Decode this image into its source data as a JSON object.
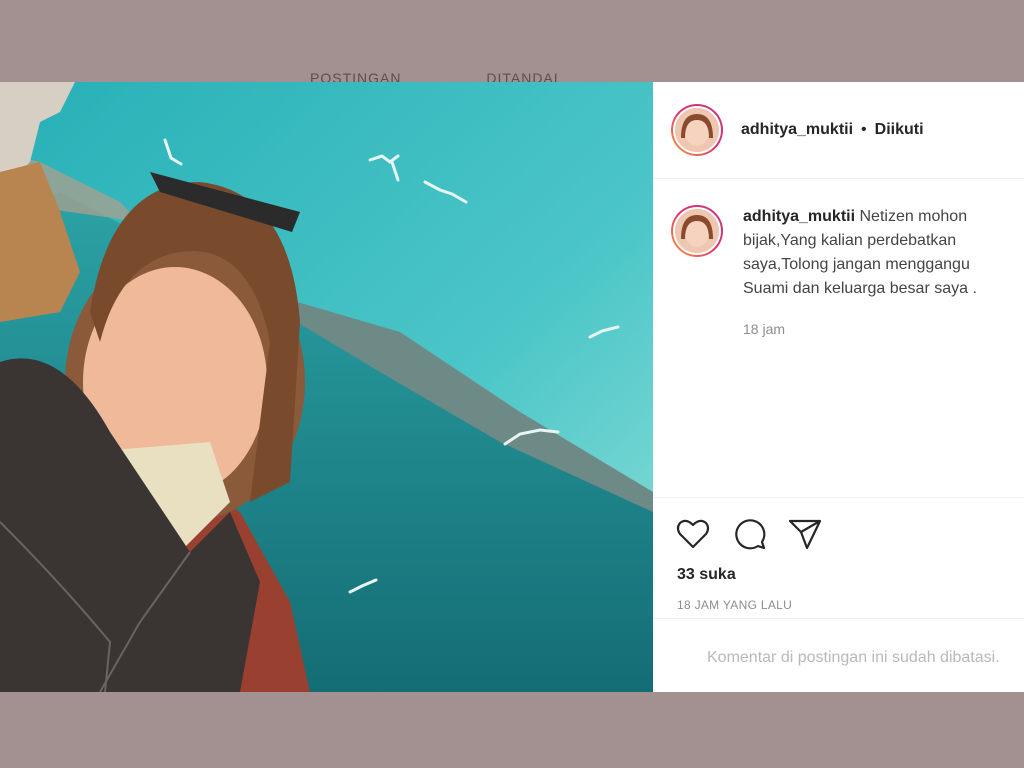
{
  "background_tabs": {
    "posts_label": "POSTINGAN",
    "tagged_label": "DITANDAI"
  },
  "post": {
    "username": "adhitya_muktii",
    "separator": "•",
    "follow_status": "Diikuti",
    "caption_username": "adhitya_muktii",
    "caption_text": "Netizen mohon bijak,Yang kalian perdebatkan saya,Tolong jangan menggangu Suami dan keluarga besar saya .",
    "caption_time": "18 jam",
    "likes": "33 suka",
    "posted_ago": "18 JAM YANG LALU",
    "comments_disabled": "Komentar di postingan ini sudah dibatasi."
  },
  "icons": [
    "heart-icon",
    "comment-icon",
    "share-icon"
  ],
  "colors": {
    "backdrop": "#a39090",
    "sky": "#2fb3b8",
    "sea": "#1d8a8f",
    "text": "#262626",
    "muted": "#8e8e8e"
  }
}
